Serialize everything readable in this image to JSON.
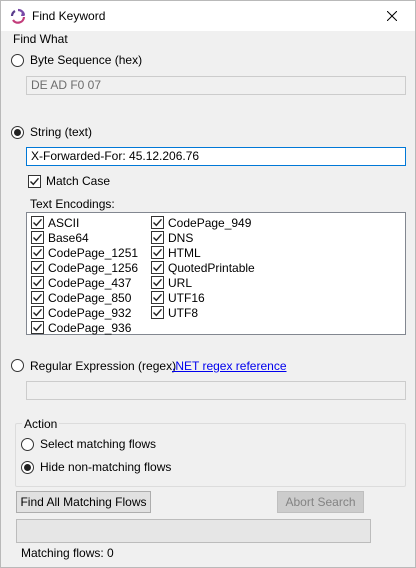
{
  "window": {
    "title": "Find Keyword"
  },
  "find_what": {
    "group_label": "Find What",
    "byte_sequence": {
      "label": "Byte Sequence (hex)",
      "selected": false,
      "value": "DE AD F0 07"
    },
    "string": {
      "label": "String (text)",
      "selected": true,
      "value": "X-Forwarded-For: 45.12.206.76"
    },
    "match_case": {
      "label": "Match Case",
      "checked": true
    },
    "text_encodings": {
      "label": "Text Encodings:",
      "column1": [
        "ASCII",
        "Base64",
        "CodePage_1251",
        "CodePage_1256",
        "CodePage_437",
        "CodePage_850",
        "CodePage_932",
        "CodePage_936"
      ],
      "column2": [
        "CodePage_949",
        "DNS",
        "HTML",
        "QuotedPrintable",
        "URL",
        "UTF16",
        "UTF8"
      ]
    },
    "regex": {
      "label": "Regular Expression (regex)",
      "selected": false,
      "link": ".NET regex reference",
      "value": ""
    }
  },
  "action": {
    "group_label": "Action",
    "select_matching": {
      "label": "Select matching flows",
      "selected": false
    },
    "hide_non_matching": {
      "label": "Hide non-matching flows",
      "selected": true
    }
  },
  "buttons": {
    "find_all": "Find All Matching Flows",
    "abort": "Abort Search"
  },
  "progress": 0,
  "status": {
    "matching_label": "Matching flows:",
    "matching_count": "0"
  },
  "colors": {
    "accent": "#0078d7",
    "link": "#0000ee"
  }
}
